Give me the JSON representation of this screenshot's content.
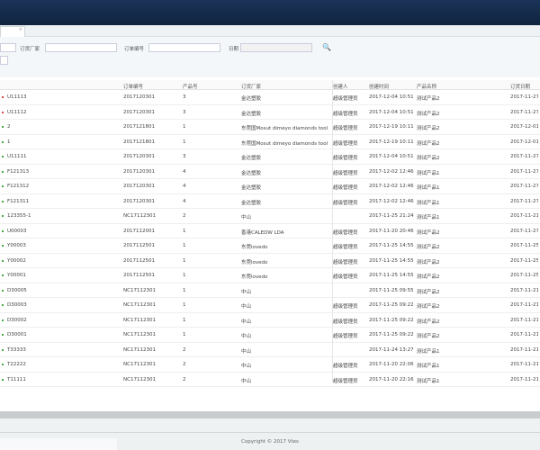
{
  "tab": {
    "close": "×"
  },
  "filters": [
    {
      "label": "订货厂家"
    },
    {
      "label": "订单编号"
    },
    {
      "label": "日期"
    }
  ],
  "columns": [
    "",
    "订单编号",
    "产品号",
    "订货厂家",
    "创建人",
    "创建时间",
    "产品名称",
    "订货日期"
  ],
  "rows": [
    {
      "status": "red",
      "cells": [
        "U11113",
        "2017120301",
        "3",
        "金达塑胶",
        "超级管理员",
        "2017-12-04 10:51",
        "测试产品2",
        "2017-11-27"
      ]
    },
    {
      "status": "red",
      "cells": [
        "U11112",
        "2017120301",
        "3",
        "金达塑胶",
        "超级管理员",
        "2017-12-04 10:51",
        "测试产品2",
        "2017-11-27"
      ]
    },
    {
      "status": "green",
      "cells": [
        "2",
        "2017121801",
        "1",
        "东莞国Mosut dimeyo diamonds tool",
        "超级管理员",
        "2017-12-19 10:11",
        "测试产品2",
        "2017-12-01"
      ]
    },
    {
      "status": "green",
      "cells": [
        "1",
        "2017121801",
        "1",
        "东莞国Mosut dimeyo diamonds tool",
        "超级管理员",
        "2017-12-19 10:11",
        "测试产品2",
        "2017-12-01"
      ]
    },
    {
      "status": "green",
      "cells": [
        "U11111",
        "2017120301",
        "3",
        "金达塑胶",
        "超级管理员",
        "2017-12-04 10:51",
        "测试产品2",
        "2017-11-27"
      ]
    },
    {
      "status": "green",
      "cells": [
        "F121313",
        "2017120301",
        "4",
        "金达塑胶",
        "超级管理员",
        "2017-12-02 12:46",
        "测试产品1",
        "2017-11-27"
      ]
    },
    {
      "status": "green",
      "cells": [
        "F121312",
        "2017120301",
        "4",
        "金达塑胶",
        "超级管理员",
        "2017-12-02 12:46",
        "测试产品1",
        "2017-11-27"
      ]
    },
    {
      "status": "green",
      "cells": [
        "F121311",
        "2017120301",
        "4",
        "金达塑胶",
        "超级管理员",
        "2017-12-02 12:46",
        "测试产品1",
        "2017-11-27"
      ]
    },
    {
      "status": "green",
      "cells": [
        "123355-1",
        "NC17112301",
        "2",
        "中山",
        "",
        "2017-11-25 21:24",
        "测试产品1",
        "2017-11-21"
      ]
    },
    {
      "status": "green",
      "cells": [
        "U00003",
        "2017112001",
        "1",
        "香港CALEDW LDA",
        "超级管理员",
        "2017-11-20 20:46",
        "测试产品2",
        "2017-11-27"
      ]
    },
    {
      "status": "green",
      "cells": [
        "Y00003",
        "2017112501",
        "1",
        "东莞lovedo",
        "超级管理员",
        "2017-11-25 14:55",
        "测试产品2",
        "2017-11-25"
      ]
    },
    {
      "status": "green",
      "cells": [
        "Y00002",
        "2017112501",
        "1",
        "东莞lovedo",
        "超级管理员",
        "2017-11-25 14:55",
        "测试产品2",
        "2017-11-25"
      ]
    },
    {
      "status": "green",
      "cells": [
        "Y00001",
        "2017112501",
        "1",
        "东莞lovedo",
        "超级管理员",
        "2017-11-25 14:55",
        "测试产品2",
        "2017-11-25"
      ]
    },
    {
      "status": "green",
      "cells": [
        "D30005",
        "NC17112301",
        "1",
        "中山",
        "",
        "2017-11-25 09:55",
        "测试产品2",
        "2017-11-21"
      ]
    },
    {
      "status": "green",
      "cells": [
        "D30003",
        "NC17112301",
        "1",
        "中山",
        "超级管理员",
        "2017-11-25 09:22",
        "测试产品2",
        "2017-11-21"
      ]
    },
    {
      "status": "green",
      "cells": [
        "D30002",
        "NC17112301",
        "1",
        "中山",
        "超级管理员",
        "2017-11-25 09:22",
        "测试产品2",
        "2017-11-21"
      ]
    },
    {
      "status": "green",
      "cells": [
        "D30001",
        "NC17112301",
        "1",
        "中山",
        "超级管理员",
        "2017-11-25 09:22",
        "测试产品2",
        "2017-11-21"
      ]
    },
    {
      "status": "green",
      "cells": [
        "T33333",
        "NC17112301",
        "2",
        "中山",
        "",
        "2017-11-24 13:27",
        "测试产品1",
        "2017-11-21"
      ]
    },
    {
      "status": "green",
      "cells": [
        "T22222",
        "NC17112301",
        "2",
        "中山",
        "超级管理员",
        "2017-11-20 22:06",
        "测试产品1",
        "2017-11-21"
      ]
    },
    {
      "status": "green",
      "cells": [
        "T11111",
        "NC17112301",
        "2",
        "中山",
        "超级管理员",
        "2017-11-20 22:16",
        "测试产品1",
        "2017-11-21"
      ]
    }
  ],
  "footer": {
    "copyright": "Copyright © 2017 Vtes"
  },
  "colors": {
    "header": "#14284a",
    "status_green": "#44aa44",
    "status_red": "#dd4444"
  }
}
